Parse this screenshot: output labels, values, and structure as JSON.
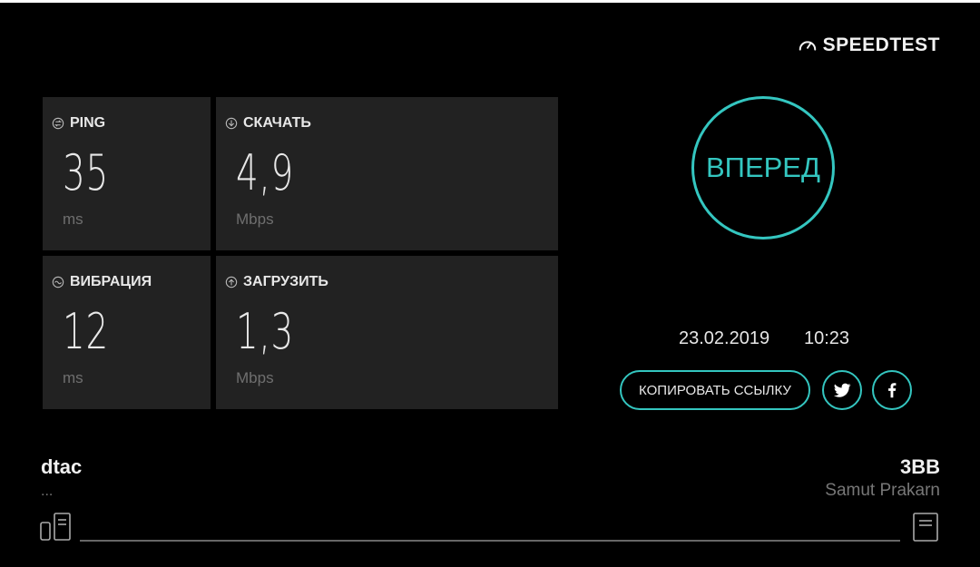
{
  "brand": {
    "name": "SPEEDTEST",
    "icon": "speedometer-icon"
  },
  "metrics": [
    {
      "label": "PING",
      "icon": "ping-icon",
      "value": "35",
      "unit": "ms"
    },
    {
      "label": "СКАЧАТЬ",
      "icon": "download-arrow-icon",
      "value": "4,9",
      "unit": "Mbps"
    },
    {
      "label": "ВИБРАЦИЯ",
      "icon": "jitter-icon",
      "value": "12",
      "unit": "ms"
    },
    {
      "label": "ЗАГРУЗИТЬ",
      "icon": "upload-arrow-icon",
      "value": "1,3",
      "unit": "Mbps"
    }
  ],
  "go_button": {
    "label": "ВПЕРЕД"
  },
  "result": {
    "date": "23.02.2019",
    "time": "10:23"
  },
  "share": {
    "copy_link_label": "КОПИРОВАТЬ ССЫЛКУ",
    "twitter_icon": "twitter-icon",
    "facebook_icon": "facebook-icon"
  },
  "isp": {
    "name": "dtac",
    "sub": "..."
  },
  "server": {
    "name": "3BB",
    "location": "Samut Prakarn"
  },
  "colors": {
    "accent": "#34c6c0",
    "tile_bg": "#222222",
    "background": "#000000"
  }
}
